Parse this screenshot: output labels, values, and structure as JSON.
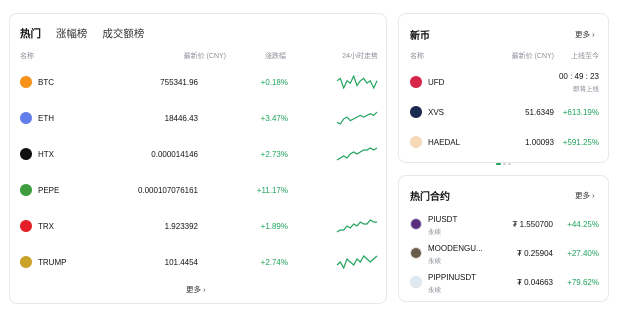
{
  "market": {
    "tabs": [
      "热门",
      "涨幅榜",
      "成交额榜"
    ],
    "headers": {
      "name": "名称",
      "price": "最新价 (CNY)",
      "change": "涨跌幅",
      "trend": "24小时走势"
    },
    "rows": [
      {
        "symbol": "BTC",
        "price": "755341.96",
        "change": "+0.18%",
        "icon": "btc-icon",
        "color": "#f7931a",
        "spark": [
          6,
          7,
          3,
          6,
          5,
          8,
          4,
          6,
          7,
          5,
          6,
          3,
          6
        ]
      },
      {
        "symbol": "ETH",
        "price": "18446.43",
        "change": "+3.47%",
        "icon": "eth-icon",
        "color": "#627eea",
        "spark": [
          3,
          2,
          5,
          6,
          4,
          5,
          6,
          7,
          6,
          7,
          8,
          7,
          9
        ]
      },
      {
        "symbol": "HTX",
        "price": "0.000014146",
        "change": "+2.73%",
        "icon": "htx-icon",
        "color": "#111111",
        "spark": [
          2,
          3,
          4,
          3,
          5,
          6,
          5,
          6,
          7,
          7,
          8,
          7,
          8
        ]
      },
      {
        "symbol": "PEPE",
        "price": "0.000107076161",
        "change": "+11.17%",
        "icon": "pepe-icon",
        "color": "#3d9c3d",
        "spark": []
      },
      {
        "symbol": "TRX",
        "price": "1.923392",
        "change": "+1.89%",
        "icon": "trx-icon",
        "color": "#e51e27",
        "spark": [
          2,
          3,
          3,
          5,
          4,
          6,
          5,
          7,
          6,
          6,
          8,
          7,
          7
        ]
      },
      {
        "symbol": "TRUMP",
        "price": "101.4454",
        "change": "+2.74%",
        "icon": "trump-icon",
        "color": "#c9a227",
        "spark": [
          4,
          5,
          3,
          6,
          5,
          4,
          6,
          5,
          7,
          6,
          5,
          6,
          7
        ]
      }
    ],
    "more_label": "更多 ›"
  },
  "new_coins": {
    "title": "新币",
    "more_label": "更多 ›",
    "headers": {
      "name": "名称",
      "price": "最新价 (CNY)",
      "listed": "上线至今"
    },
    "rows": [
      {
        "symbol": "UFD",
        "countdown": "00 : 49 : 23",
        "countdown_sub": "即将上线",
        "icon": "ufd-icon",
        "color": "#d7264a"
      },
      {
        "symbol": "XVS",
        "price": "51.6349",
        "change": "+613.19%",
        "icon": "xvs-icon",
        "color": "#1b2a4e"
      },
      {
        "symbol": "HAEDAL",
        "price": "1.00093",
        "change": "+591.25%",
        "icon": "haedal-icon",
        "color": "#f5d9b8"
      }
    ]
  },
  "hot_contracts": {
    "title": "热门合约",
    "more_label": "更多 ›",
    "rows": [
      {
        "symbol": "PIUSDT",
        "type": "永续",
        "price": "₮ 1.550700",
        "change": "+44.25%",
        "icon": "pi-icon",
        "color": "#5a2d82"
      },
      {
        "symbol": "MOODENGU...",
        "type": "永续",
        "price": "₮ 0.25904",
        "change": "+27.40%",
        "icon": "moodeng-icon",
        "color": "#6b5b4b"
      },
      {
        "symbol": "PIPPINUSDT",
        "type": "永续",
        "price": "₮ 0.04663",
        "change": "+79.62%",
        "icon": "pippin-icon",
        "color": "#dfe9f2"
      }
    ]
  }
}
